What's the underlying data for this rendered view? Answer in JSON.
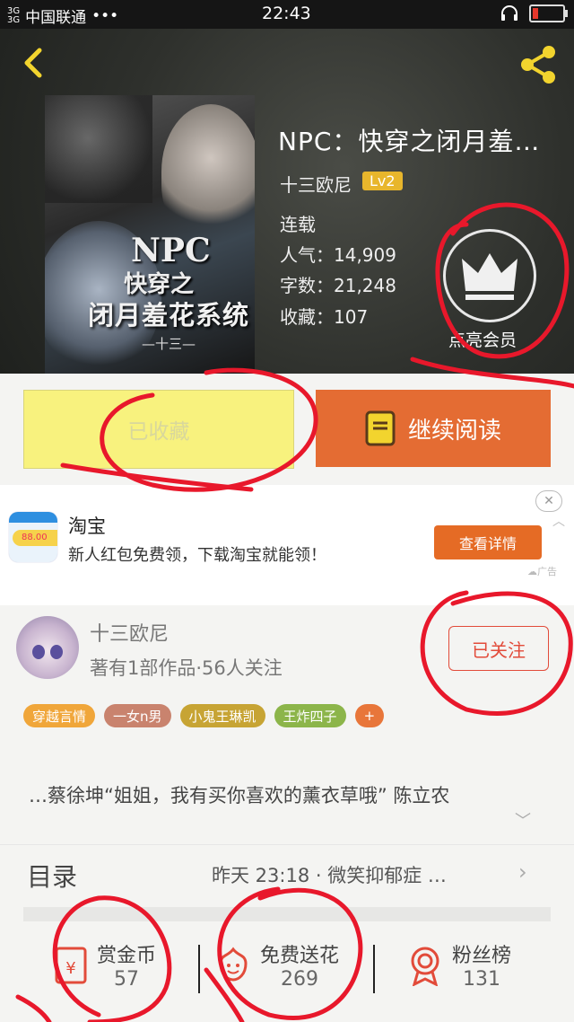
{
  "status_bar": {
    "network1": "3G",
    "network2": "3G",
    "carrier": "中国联通",
    "dots": "•••",
    "time": "22:43"
  },
  "book": {
    "title": "NPC：快穿之闭月羞…",
    "author": "十三欧尼",
    "level": "Lv2",
    "status": "连载",
    "popularity_label": "人气：",
    "popularity": "14,909",
    "words_label": "字数：",
    "words": "21,248",
    "favorites_label": "收藏：",
    "favorites": "107",
    "cover_text": {
      "line1": "NPC",
      "line2": "快穿之",
      "line3": "闭月羞花系统",
      "line4": "—十三—"
    },
    "vip_label": "点亮会员"
  },
  "actions": {
    "favorite_label": "已收藏",
    "read_label": "继续阅读"
  },
  "ad": {
    "app_name": "淘宝",
    "description": "新人红包免费领，下载淘宝就能领！",
    "cta": "查看详情",
    "tag": "广告",
    "logo_amount": "88.00"
  },
  "author_card": {
    "name": "十三欧尼",
    "info": "著有1部作品·56人关注",
    "follow_label": "已关注",
    "tags": [
      {
        "label": "穿越言情",
        "color": "#f0a63a"
      },
      {
        "label": "一女n男",
        "color": "#c9836e"
      },
      {
        "label": "小鬼王琳凯",
        "color": "#c7a434"
      },
      {
        "label": "王炸四子",
        "color": "#8cb54a"
      },
      {
        "label": "+",
        "color": "#e8763a"
      }
    ]
  },
  "intro": "…蔡徐坤“姐姐，我有买你喜欢的薰衣草哦” 陈立农",
  "toc": {
    "label": "目录",
    "latest": "昨天 23:18 · 微笑抑郁症 …"
  },
  "stats": [
    {
      "label": "赏金币",
      "value": "57"
    },
    {
      "label": "免费送花",
      "value": "269"
    },
    {
      "label": "粉丝榜",
      "value": "131"
    }
  ],
  "colors": {
    "accent_orange": "#e46c33",
    "fav_yellow": "#f8f27e",
    "annotation_red": "#e8182b"
  }
}
